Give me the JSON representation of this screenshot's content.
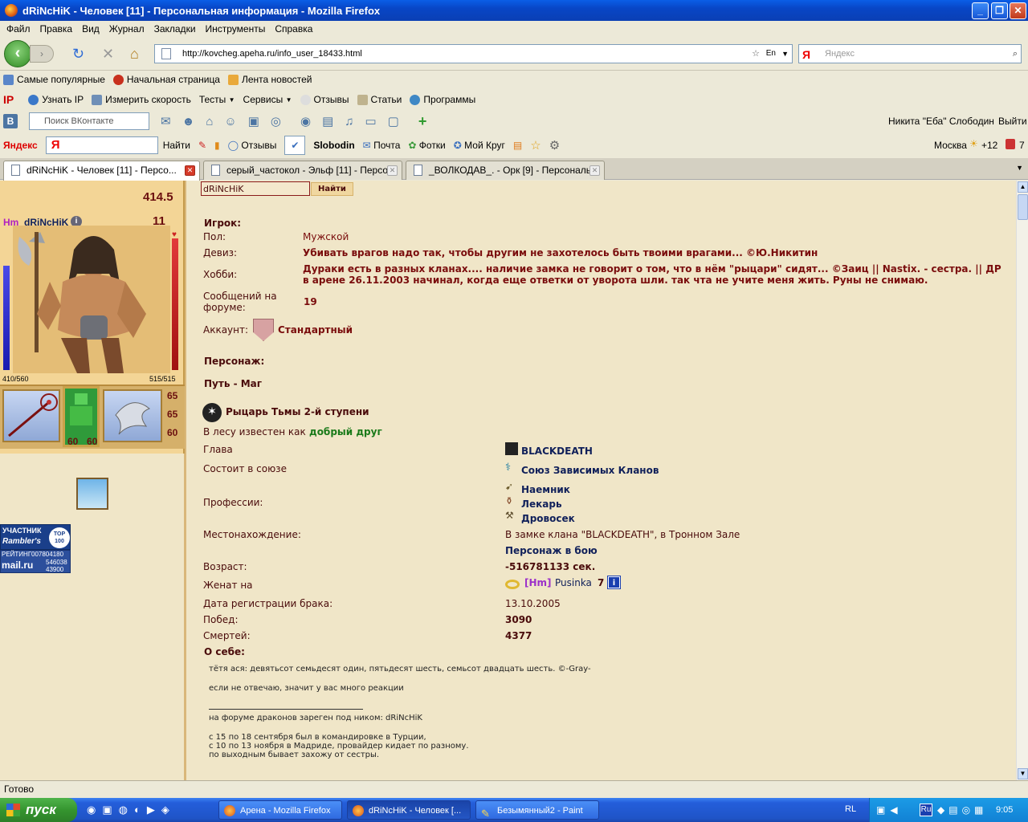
{
  "window": {
    "title": "dRiNcHiK - Человек [11] - Персональная информация - Mozilla Firefox"
  },
  "menu": [
    "Файл",
    "Правка",
    "Вид",
    "Журнал",
    "Закладки",
    "Инструменты",
    "Справка"
  ],
  "nav": {
    "url": "http://kovcheg.apeha.ru/info_user_18433.html",
    "lang": "En",
    "search_placeholder": "Яндекс",
    "search_logo": "Я"
  },
  "bookmarks": [
    "Самые популярные",
    "Начальная страница",
    "Лента новостей"
  ],
  "ucoz_bar": {
    "logo": "IP",
    "items": [
      "Узнать IP",
      "Измерить скорость",
      "Тесты",
      "Сервисы",
      "Отзывы",
      "Статьи",
      "Программы"
    ]
  },
  "vk_bar": {
    "logo": "B",
    "search_placeholder": "Поиск ВКонтакте",
    "user": "Никита \"Еба\" Слободин",
    "logout": "Выйти"
  },
  "yandex_bar": {
    "logo": "Яндекс",
    "input_logo": "Я",
    "find": "Найти",
    "reviews": "Отзывы",
    "username": "Slobodin",
    "mail": "Почта",
    "photos": "Фотки",
    "circle": "Мой Круг",
    "city": "Москва",
    "temp": "+12",
    "count": "7"
  },
  "tabs": [
    {
      "label": "dRiNcHiK - Человек [11] - Персо..."
    },
    {
      "label": "серый_частокол - Эльф [11] - Персо..."
    },
    {
      "label": "_ВОЛКОДАВ_. - Орк [9] - Персональ..."
    }
  ],
  "character": {
    "score": "414.5",
    "race": "Hm",
    "name": "dRiNcHiK",
    "level": "11",
    "hp": "410/560",
    "mana": "515/515",
    "equip_stats": [
      "65",
      "65",
      "60"
    ],
    "armor_stats": [
      "60",
      "60"
    ]
  },
  "banners": {
    "rambler_top": "УЧАСТНИК",
    "rambler_name": "Rambler's",
    "rambler_badge": "TOP 100",
    "rating": "РЕЙТИНГ",
    "rating_value": "007804180",
    "mailru": "mail.ru",
    "mail_n1": "546038",
    "mail_n2": "43900"
  },
  "search": {
    "value": "dRiNcHiK",
    "button": "Найти"
  },
  "player": {
    "header": "Игрок:",
    "gender_label": "Пол:",
    "gender": "Мужской",
    "motto_label": "Девиз:",
    "motto": "Убивать врагов надо так, чтобы другим не захотелось быть твоими врагами... ©Ю.Никитин",
    "hobby_label": "Хобби:",
    "hobby": "Дураки есть в разных кланах.... наличие замка не говорит о том, что в нём \"рыцари\" сидят... ©Заиц || Nastix. - сестра. || ДР в арене 26.11.2003 начинал, когда еще ответки от уворота шли. так чта не учите меня жить. Руны не снимаю.",
    "posts_label": "Сообщений на форуме:",
    "posts": "19",
    "account_label": "Аккаунт:",
    "account": "Стандартный"
  },
  "persona": {
    "header": "Персонаж:",
    "path": "Путь - Маг",
    "rank": "Рыцарь Тьмы 2-й ступени",
    "forest_prefix": "В лесу известен как",
    "forest": "добрый друг",
    "rows": [
      {
        "label": "Глава",
        "value": "BLACKDEATH"
      },
      {
        "label": "Состоит в союзе",
        "value": "Союз Зависимых Кланов"
      },
      {
        "label": "Профессии:",
        "values": [
          "Наемник",
          "Лекарь",
          "Дровосек"
        ]
      },
      {
        "label": "Местонахождение:",
        "value": "В замке клана \"BLACKDEATH\", в Тронном Зале",
        "value2": "Персонаж в бою"
      },
      {
        "label": "Возраст:",
        "value": "-516781133 сек."
      },
      {
        "label": "Женат на",
        "tag": "[Hm]",
        "value": "Pusinka",
        "level": "7"
      },
      {
        "label": "Дата регистрации брака:",
        "value": "13.10.2005"
      },
      {
        "label": "Побед:",
        "value": "3090"
      },
      {
        "label": "Смертей:",
        "value": "4377"
      }
    ]
  },
  "about": {
    "header": "О себе:",
    "lines": [
      "тётя ася: девятьсот семьдесят один, пятьдесят шесть, семьсот двадцать шесть. ©-Gray-",
      "если не отвечаю, значит у вас много реакции",
      "на форуме драконов зареген под ником: dRiNcHiK",
      "с 15 по 18 сентября был в командировке в Турции,",
      "с 10 по 13 ноября в Мадриде, провайдер кидает по разному.",
      "по выходным бывает захожу от сестры."
    ]
  },
  "status": "Готово",
  "taskbar": {
    "start": "пуск",
    "tasks": [
      "Арена - Mozilla Firefox",
      "dRiNcHiK - Человек [...",
      "Безымянный2 - Paint"
    ],
    "lang": "RL",
    "tray_lang": "Ru",
    "clock": "9:05"
  },
  "colors": {
    "page_bg": "#f0e6c8",
    "text_dark_red": "#7a0d0d",
    "navy": "#10205a",
    "green": "#1a7a1a",
    "purple": "#9b30c9"
  }
}
